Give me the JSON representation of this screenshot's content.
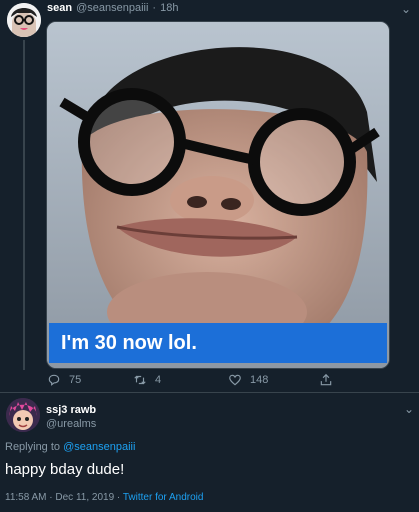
{
  "tweet": {
    "author_name": "sean",
    "author_handle": "@seansenpaiii",
    "separator": "·",
    "time": "18h",
    "caption": "I'm 30 now lol.",
    "actions": {
      "replies": "75",
      "retweets": "4",
      "likes": "148"
    },
    "icons": [
      "reply-icon",
      "retweet-icon",
      "like-icon",
      "share-icon"
    ]
  },
  "reply": {
    "author_name": "ssj3 rawb",
    "author_handle": "@urealms",
    "replying_prefix": "Replying to",
    "replying_handle": "@seansenpaiii",
    "text": "happy bday dude!",
    "timestamp": "11:58 AM · Dec 11, 2019 · ",
    "source": "Twitter for Android"
  },
  "colors": {
    "background": "#15202b",
    "accent": "#1da1f2",
    "muted": "#8899a6",
    "caption_bg": "#1c6fd8"
  }
}
